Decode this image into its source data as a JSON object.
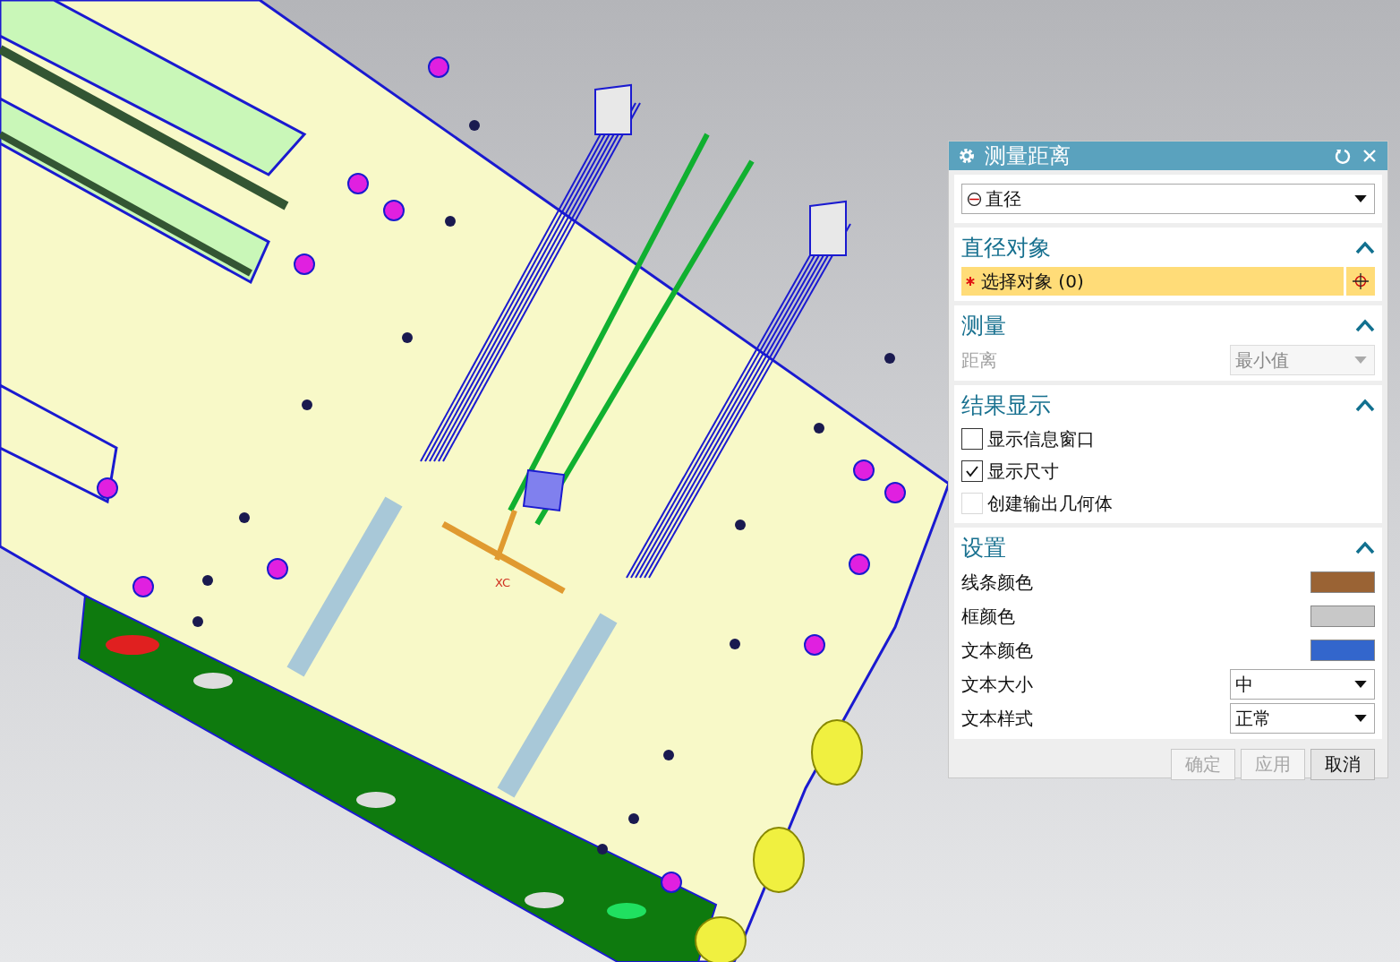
{
  "viewport": {
    "axis_label": "XC"
  },
  "dialog": {
    "title": "测量距离",
    "type_select": {
      "value": "直径"
    },
    "sections": [
      {
        "kind": "selection",
        "title": "直径对象",
        "expanded": true,
        "label": "选择对象 (0)",
        "required": true
      },
      {
        "kind": "measure",
        "title": "测量",
        "expanded": true,
        "label": "距离",
        "value": "最小值",
        "disabled": true
      },
      {
        "kind": "checks",
        "title": "结果显示",
        "expanded": true,
        "items": [
          {
            "label": "显示信息窗口",
            "checked": false,
            "disabled": false
          },
          {
            "label": "显示尺寸",
            "checked": true,
            "disabled": false
          },
          {
            "label": "创建输出几何体",
            "checked": false,
            "disabled": true
          }
        ]
      },
      {
        "kind": "settings",
        "title": "设置",
        "expanded": true,
        "rows": [
          {
            "kind": "color",
            "label": "线条颜色",
            "color": "#9a6334"
          },
          {
            "kind": "color",
            "label": "框颜色",
            "color": "#c8c8c8"
          },
          {
            "kind": "color",
            "label": "文本颜色",
            "color": "#3366cc"
          },
          {
            "kind": "select",
            "label": "文本大小",
            "value": "中"
          },
          {
            "kind": "select",
            "label": "文本样式",
            "value": "正常"
          }
        ]
      }
    ],
    "buttons": [
      {
        "label": "确定",
        "disabled": true
      },
      {
        "label": "应用",
        "disabled": true
      },
      {
        "label": "取消",
        "disabled": false
      }
    ]
  }
}
